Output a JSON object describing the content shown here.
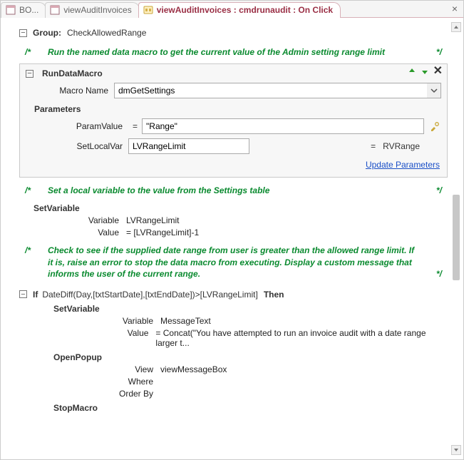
{
  "tabs": {
    "items": [
      {
        "label": "BO...",
        "icon": "form-icon"
      },
      {
        "label": "viewAuditInvoices",
        "icon": "form-icon"
      },
      {
        "label": "viewAuditInvoices : cmdrunaudit : On Click",
        "icon": "macro-icon"
      }
    ],
    "active_index": 2
  },
  "group": {
    "label": "Group:",
    "name": "CheckAllowedRange"
  },
  "comment1": "Run the named data macro to get the current value of the Admin setting range limit",
  "rdm": {
    "title": "RunDataMacro",
    "macro_name_label": "Macro Name",
    "macro_name_value": "dmGetSettings",
    "parameters_label": "Parameters",
    "param_value_label": "ParamValue",
    "param_value_value": "\"Range\"",
    "set_local_var_label": "SetLocalVar",
    "set_local_var_value": "LVRangeLimit",
    "rv_label": "RVRange",
    "update_link": "Update Parameters"
  },
  "comment2": "Set a local variable to the value from the Settings table",
  "setvar1": {
    "title": "SetVariable",
    "variable_label": "Variable",
    "variable_value": "LVRangeLimit",
    "value_label": "Value",
    "value_value": "= [LVRangeLimit]-1"
  },
  "comment3": "Check to see if the supplied date range from user is greater than the allowed range limit. If it is, raise an error to stop the data macro from executing. Display a custom message that informs the user of the current range.",
  "ifblock": {
    "if_kw": "If",
    "condition": "DateDiff(Day,[txtStartDate],[txtEndDate])>[LVRangeLimit]",
    "then_kw": "Then",
    "setvar": {
      "title": "SetVariable",
      "variable_label": "Variable",
      "variable_value": "MessageText",
      "value_label": "Value",
      "value_value": "= Concat(\"You have attempted to run an invoice audit with a date range larger t..."
    },
    "openpopup": {
      "title": "OpenPopup",
      "view_label": "View",
      "view_value": "viewMessageBox",
      "where_label": "Where",
      "where_value": "",
      "orderby_label": "Order By",
      "orderby_value": ""
    },
    "stopmacro": {
      "title": "StopMacro"
    }
  },
  "slash_open": "/*",
  "slash_close": "*/",
  "equals": "="
}
